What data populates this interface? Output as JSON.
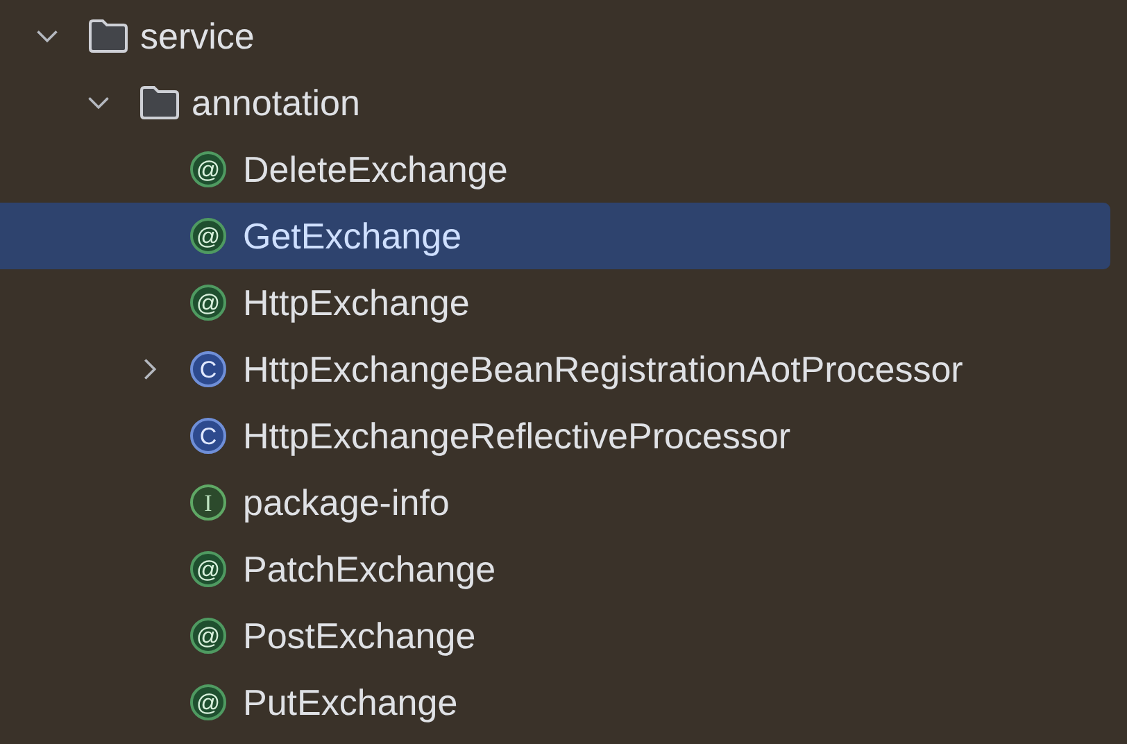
{
  "tree": [
    {
      "label": "service",
      "kind": "folder",
      "expanded": true,
      "selected": false,
      "children": [
        {
          "label": "annotation",
          "kind": "folder",
          "expanded": true,
          "selected": false,
          "children": [
            {
              "label": "DeleteExchange",
              "kind": "annotation",
              "glyph": "@",
              "selected": false
            },
            {
              "label": "GetExchange",
              "kind": "annotation",
              "glyph": "@",
              "selected": true
            },
            {
              "label": "HttpExchange",
              "kind": "annotation",
              "glyph": "@",
              "selected": false
            },
            {
              "label": "HttpExchangeBeanRegistrationAotProcessor",
              "kind": "class",
              "glyph": "C",
              "expanded": false,
              "selected": false
            },
            {
              "label": "HttpExchangeReflectiveProcessor",
              "kind": "class",
              "glyph": "C",
              "selected": false
            },
            {
              "label": "package-info",
              "kind": "interface",
              "glyph": "I",
              "selected": false
            },
            {
              "label": "PatchExchange",
              "kind": "annotation",
              "glyph": "@",
              "selected": false
            },
            {
              "label": "PostExchange",
              "kind": "annotation",
              "glyph": "@",
              "selected": false
            },
            {
              "label": "PutExchange",
              "kind": "annotation",
              "glyph": "@",
              "selected": false
            }
          ]
        }
      ]
    }
  ]
}
